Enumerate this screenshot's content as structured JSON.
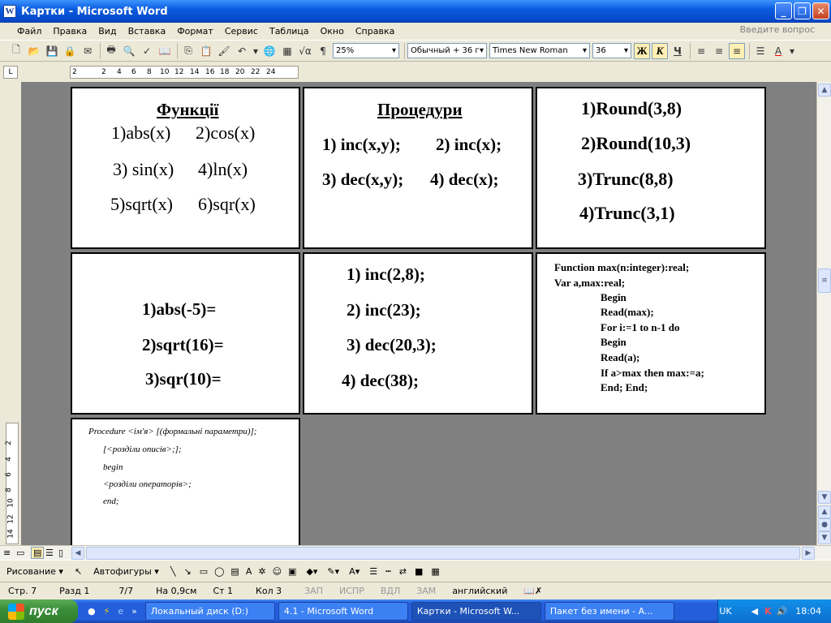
{
  "window": {
    "title": "Картки - Microsoft Word",
    "app_icon": "W"
  },
  "menu": {
    "items": [
      "Файл",
      "Правка",
      "Вид",
      "Вставка",
      "Формат",
      "Сервис",
      "Таблица",
      "Окно",
      "Справка"
    ],
    "ask_placeholder": "Введите вопрос"
  },
  "toolbar": {
    "zoom": "25%",
    "style": "Обычный + 36 г",
    "font": "Times New Roman",
    "size": "36",
    "bold": "Ж",
    "italic": "К",
    "underline": "Ч"
  },
  "ruler": {
    "ticks": [
      "2",
      "2",
      "4",
      "6",
      "8",
      "10",
      "12",
      "14",
      "16",
      "18",
      "20",
      "22",
      "24"
    ],
    "vticks": [
      "2",
      "4",
      "6",
      "8",
      "10",
      "12",
      "14"
    ]
  },
  "cards": {
    "c1": {
      "title": "Функції",
      "l1a": "1)abs(x)",
      "l1b": "2)cos(x)",
      "l2a": "3) sin(x)",
      "l2b": "4)ln(x)",
      "l3a": "5)sqrt(x)",
      "l3b": "6)sqr(x)"
    },
    "c2": {
      "title": "Процедури",
      "l1a": "1) inc(x,y);",
      "l1b": "2) inc(x);",
      "l2a": "3) dec(x,y);",
      "l2b": "4) dec(x);"
    },
    "c3": {
      "l1": "1)Round(3,8)",
      "l2": "2)Round(10,3)",
      "l3": "3)Trunc(8,8)",
      "l4": "4)Trunc(3,1)"
    },
    "c4": {
      "l1": "1)abs(-5)=",
      "l2": "2)sqrt(16)=",
      "l3": "3)sqr(10)="
    },
    "c5": {
      "l1": "1) inc(2,8);",
      "l2": "2) inc(23);",
      "l3": "3) dec(20,3);",
      "l4": "4) dec(38);"
    },
    "c6": {
      "l1": "Function max(n:integer):real;",
      "l2": "Var a,max:real;",
      "l3": "Begin",
      "l4": "Read(max);",
      "l5": "For i:=1 to n-1 do",
      "l6": "Begin",
      "l7": "Read(a);",
      "l8": "If a>max then max:=a;",
      "l9": "End; End;"
    },
    "c7": {
      "l1": "Procedure <ім'я> [(формальні параметри)];",
      "l2": "[<розділи описів>;];",
      "l3": "begin",
      "l4": "<розділи операторів>;",
      "l5": "end;"
    }
  },
  "drawing": {
    "draw": "Рисование",
    "autoshapes": "Автофигуры"
  },
  "status": {
    "page": "Стр. 7",
    "section": "Разд 1",
    "pages": "7/7",
    "at": "На 0,9см",
    "line": "Ст 1",
    "col": "Кол 3",
    "rec": "ЗАП",
    "trk": "ИСПР",
    "ext": "ВДЛ",
    "ovr": "ЗАМ",
    "lang": "английский"
  },
  "taskbar": {
    "start": "пуск",
    "tasks": [
      "Локальный диск (D:)",
      "4.1 - Microsoft Word",
      "Картки - Microsoft W...",
      "Пакет без имени - А..."
    ],
    "lang": "UK",
    "clock": "18:04"
  }
}
